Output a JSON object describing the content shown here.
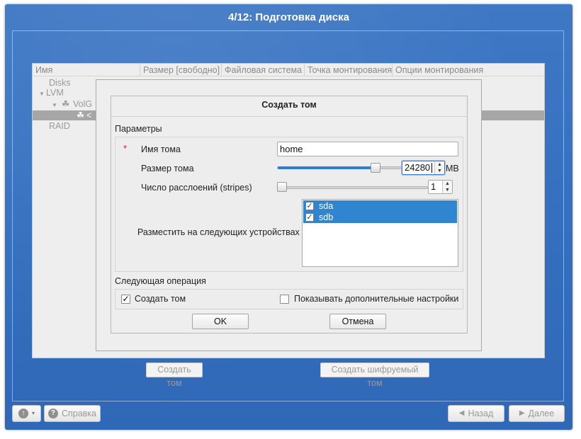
{
  "window": {
    "title": "4/12: Подготовка диска"
  },
  "background": {
    "columns": [
      "Имя",
      "Размер [свободно]",
      "Файловая система",
      "Точка монтирования",
      "Опции монтирования"
    ],
    "tree": {
      "disks": "Disks",
      "lvm": "LVM",
      "vg": "VolG",
      "lv": "<",
      "raid": "RAID"
    },
    "buttons": {
      "create_volume": "Создать том",
      "create_encrypted": "Создать шифруемый том"
    }
  },
  "footer": {
    "help": "Справка",
    "back": "Назад",
    "next": "Далее"
  },
  "dialog": {
    "title": "Создать том",
    "params_label": "Параметры",
    "required_mark": "*",
    "name_label": "Имя тома",
    "name_value": "home",
    "size_label": "Размер тома",
    "size_value": "24280",
    "size_unit": "MB",
    "size_fraction": 0.79,
    "stripes_label": "Число расслоений (stripes)",
    "stripes_value": "1",
    "stripes_fraction": 0.0,
    "devices_label": "Разместить на следующих устройствах",
    "devices": [
      {
        "name": "sda",
        "checked": true
      },
      {
        "name": "sdb",
        "checked": true
      }
    ],
    "next_op_label": "Следующая операция",
    "create_volume_checkbox": {
      "label": "Создать том",
      "checked": true
    },
    "advanced_checkbox": {
      "label": "Показывать дополнительные настройки",
      "checked": false
    },
    "ok_label": "OK",
    "cancel_label": "Отмена"
  },
  "colors": {
    "accent": "#2f85cf",
    "window_bg": "#3470bf",
    "required": "#cc2222"
  }
}
